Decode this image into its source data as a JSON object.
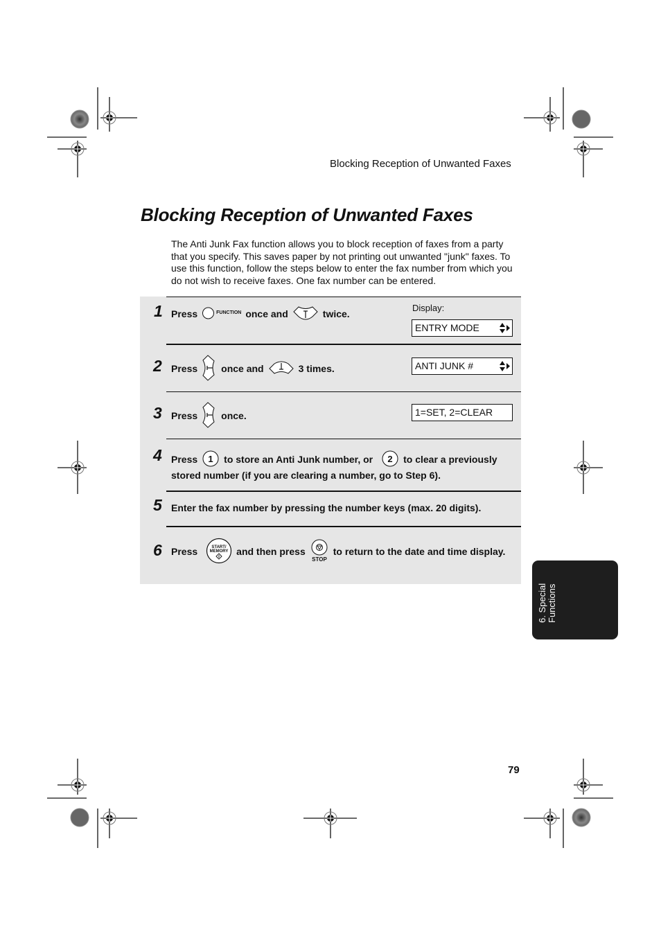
{
  "header": {
    "running_title": "Blocking Reception of Unwanted Faxes"
  },
  "title": "Blocking Reception of Unwanted Faxes",
  "intro": "The Anti Junk Fax function allows you to block reception of faxes from a party that you specify. This saves paper by not printing out unwanted \"junk\" faxes. To use this function, follow the steps below to enter the fax number from which you do not wish to receive faxes. One fax number can be entered.",
  "display_label": "Display:",
  "steps": [
    {
      "num": "1",
      "parts": [
        "Press",
        "once and",
        "twice."
      ],
      "keys": [
        "function-key",
        "up-arrow-key"
      ],
      "key_labels": [
        "FUNCTION"
      ],
      "display": "ENTRY MODE",
      "display_arrows": true
    },
    {
      "num": "2",
      "parts": [
        "Press",
        "once and",
        "3 times."
      ],
      "keys": [
        "right-arrow-key",
        "down-arrow-key"
      ],
      "display": "ANTI JUNK #",
      "display_arrows": true
    },
    {
      "num": "3",
      "parts": [
        "Press",
        "once."
      ],
      "keys": [
        "right-arrow-key"
      ],
      "display": "1=SET, 2=CLEAR",
      "display_arrows": false
    },
    {
      "num": "4",
      "parts": [
        "Press",
        "to store an Anti Junk number, or",
        "to clear a previously"
      ],
      "line2": "stored number (if you are clearing a number, go to Step 6).",
      "keys": [
        "1",
        "2"
      ]
    },
    {
      "num": "5",
      "text": "Enter the fax number by pressing the number keys (max. 20 digits)."
    },
    {
      "num": "6",
      "parts": [
        "Press",
        "and then press",
        "to return to the date and time display."
      ],
      "key_labels": [
        "START/",
        "MEMORY",
        "STOP"
      ]
    }
  ],
  "side_tab": {
    "line1": "6. Special",
    "line2": "Functions"
  },
  "page_number": "79"
}
